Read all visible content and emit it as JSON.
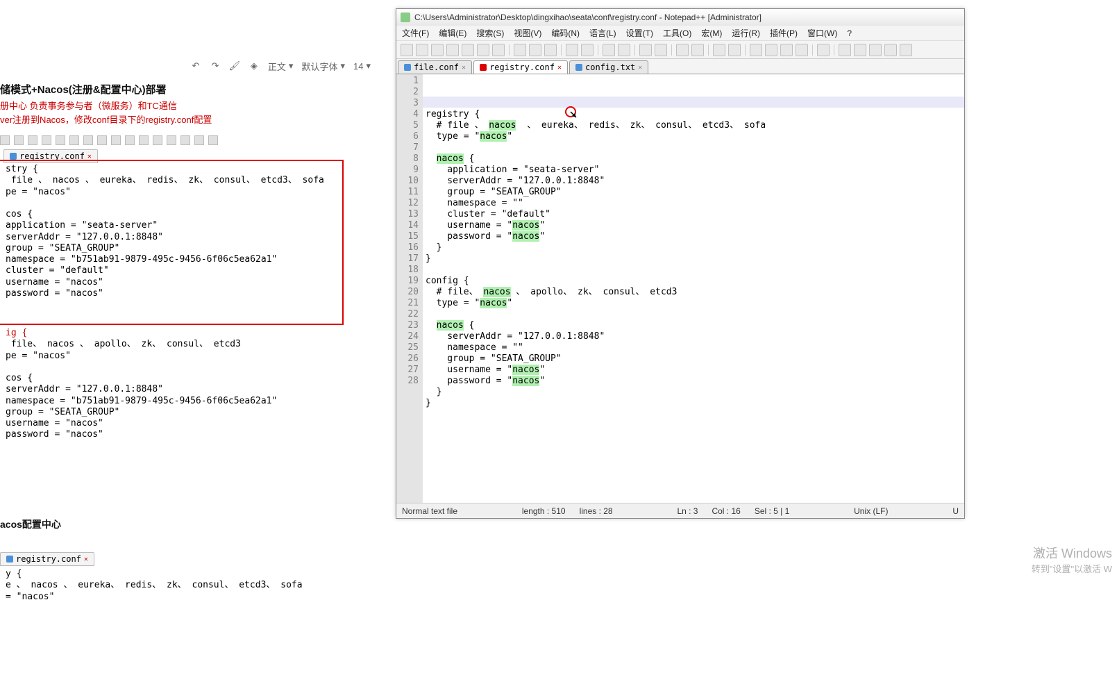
{
  "left": {
    "toolbar": {
      "style_label": "正文",
      "font_label": "默认字体",
      "size": "14"
    },
    "heading": "储模式+Nacos(注册&配置中心)部署",
    "subhead": "册中心 负责事务参与者（微服务）和TC通信",
    "note": "ver注册到Nacos，修改conf目录下的registry.conf配置",
    "tab": "registry.conf",
    "code_box1": "stry {\n file 、 nacos 、 eureka、 redis、 zk、 consul、 etcd3、 sofa\npe = \"nacos\"\n\ncos {\napplication = \"seata-server\"\nserverAddr = \"127.0.0.1:8848\"\ngroup = \"SEATA_GROUP\"\nnamespace = \"b751ab91-9879-495c-9456-6f06c5ea62a1\"\ncluster = \"default\"\nusername = \"nacos\"\npassword = \"nacos\"",
    "code_box2": "ig {\n file、 nacos 、 apollo、 zk、 consul、 etcd3\npe = \"nacos\"\n\ncos {\nserverAddr = \"127.0.0.1:8848\"\nnamespace = \"b751ab91-9879-495c-9456-6f06c5ea62a1\"\ngroup = \"SEATA_GROUP\"\nusername = \"nacos\"\npassword = \"nacos\"",
    "section2_title": "acos配置中心",
    "tab2": "registry.conf",
    "code_box3": "y {\ne 、 nacos 、 eureka、 redis、 zk、 consul、 etcd3、 sofa\n= \"nacos\""
  },
  "npp": {
    "title": "C:\\Users\\Administrator\\Desktop\\dingxihao\\seata\\conf\\registry.conf - Notepad++ [Administrator]",
    "menus": [
      "文件(F)",
      "编辑(E)",
      "搜索(S)",
      "视图(V)",
      "编码(N)",
      "语言(L)",
      "设置(T)",
      "工具(O)",
      "宏(M)",
      "运行(R)",
      "插件(P)",
      "窗口(W)",
      "?"
    ],
    "tabs": [
      {
        "name": "file.conf",
        "active": false
      },
      {
        "name": "registry.conf",
        "active": true
      },
      {
        "name": "config.txt",
        "active": false
      }
    ],
    "code_lines": [
      "registry {",
      "  # file 、 nacos  、 eureka、 redis、 zk、 consul、 etcd3、 sofa",
      "  type = \"nacos\"",
      "",
      "  nacos {",
      "    application = \"seata-server\"",
      "    serverAddr = \"127.0.0.1:8848\"",
      "    group = \"SEATA_GROUP\"",
      "    namespace = \"\"",
      "    cluster = \"default\"",
      "    username = \"nacos\"",
      "    password = \"nacos\"",
      "  }",
      "}",
      "",
      "config {",
      "  # file、 nacos 、 apollo、 zk、 consul、 etcd3",
      "  type = \"nacos\"",
      "",
      "  nacos {",
      "    serverAddr = \"127.0.0.1:8848\"",
      "    namespace = \"\"",
      "    group = \"SEATA_GROUP\"",
      "    username = \"nacos\"",
      "    password = \"nacos\"",
      "  }",
      "}",
      ""
    ],
    "highlight_word": "nacos",
    "current_line": 3,
    "status": {
      "filetype": "Normal text file",
      "length": "length : 510",
      "lines": "lines : 28",
      "ln": "Ln : 3",
      "col": "Col : 16",
      "sel": "Sel : 5 | 1",
      "eol": "Unix (LF)",
      "enc": "U"
    }
  },
  "watermark": {
    "title": "激活 Windows",
    "sub": "转到\"设置\"以激活 W"
  }
}
